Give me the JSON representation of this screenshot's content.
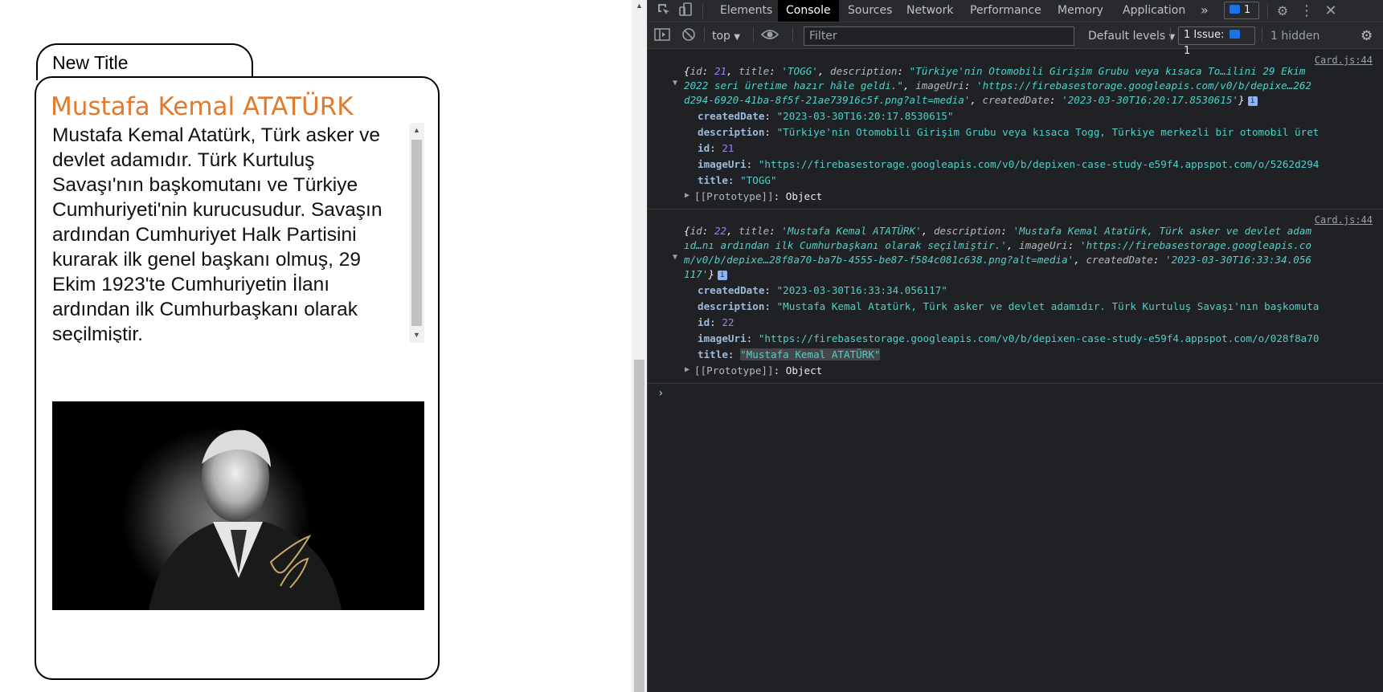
{
  "page": {
    "tab_title": "New Title",
    "card": {
      "name": "Mustafa Kemal ATATÜRK",
      "description": "Mustafa Kemal Atatürk, Türk asker ve devlet adamıdır. Türk Kurtuluş Savaşı'nın başkomutanı ve Türkiye Cumhuriyeti'nin kurucusudur. Savaşın ardından Cumhuriyet Halk Partisini kurarak ilk genel başkanı olmuş, 29 Ekim 1923'te Cumhuriyetin İlanı ardından ilk Cumhurbaşkanı olarak seçilmiştir."
    }
  },
  "devtools": {
    "tabs": [
      "Elements",
      "Console",
      "Sources",
      "Network",
      "Performance",
      "Memory",
      "Application"
    ],
    "active_tab": "Console",
    "more_tabs": "»",
    "message_count": "1",
    "toolbar": {
      "context": "top",
      "filter_placeholder": "Filter",
      "levels": "Default levels",
      "issues": "1 Issue:",
      "issues_count": "1",
      "hidden": "1 hidden"
    },
    "logs": [
      {
        "source": "Card.js:44",
        "summary": {
          "id": "21",
          "title": "'TOGG'",
          "description_start": "\"Türkiye'nin Otomobili Girişim Grubu veya kısaca To…ilini 29 Ekim",
          "description_end": "2022 seri üretime hazır hâle geldi.\"",
          "imageUri": "'https://firebasestorage.googleapis.com/v0/b/depixe…262",
          "imageUri_end": "d294-6920-41ba-8f5f-21ae73916c5f.png?alt=media'",
          "createdDate": "'2023-03-30T16:20:17.8530615'"
        },
        "props": {
          "createdDate": "\"2023-03-30T16:20:17.8530615\"",
          "description": "\"Türkiye'nin Otomobili Girişim Grubu veya kısaca Togg, Türkiye merkezli bir otomobil üret",
          "id": "21",
          "imageUri": "\"https://firebasestorage.googleapis.com/v0/b/depixen-case-study-e59f4.appspot.com/o/5262d294",
          "title": "\"TOGG\"",
          "prototype": "Object"
        }
      },
      {
        "source": "Card.js:44",
        "summary": {
          "id": "22",
          "title": "'Mustafa Kemal ATATÜRK'",
          "description_start": "'Mustafa Kemal Atatürk, Türk asker ve devlet adam",
          "description_mid": "ıd…nı ardından ilk Cumhurbaşkanı olarak seçilmiştir.'",
          "imageUri": "'https://firebasestorage.googleapis.co",
          "imageUri_end": "m/v0/b/depixe…28f8a70-ba7b-4555-be87-f584c081c638.png?alt=media'",
          "createdDate": "'2023-03-30T16:33:34.056",
          "createdDate_end": "117'"
        },
        "props": {
          "createdDate": "\"2023-03-30T16:33:34.056117\"",
          "description": "\"Mustafa Kemal Atatürk, Türk asker ve devlet adamıdır. Türk Kurtuluş Savaşı'nın başkomuta",
          "id": "22",
          "imageUri": "\"https://firebasestorage.googleapis.com/v0/b/depixen-case-study-e59f4.appspot.com/o/028f8a70",
          "title": "\"Mustafa Kemal ATATÜRK\"",
          "prototype": "Object"
        }
      }
    ],
    "prompt": "›"
  }
}
